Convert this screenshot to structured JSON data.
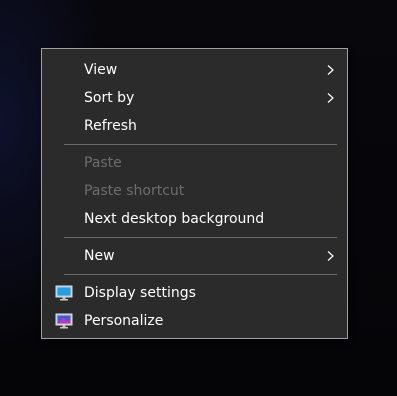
{
  "context_menu": {
    "items": [
      {
        "label": "View",
        "has_submenu": true,
        "enabled": true
      },
      {
        "label": "Sort by",
        "has_submenu": true,
        "enabled": true
      },
      {
        "label": "Refresh",
        "has_submenu": false,
        "enabled": true
      },
      {
        "label": "Paste",
        "has_submenu": false,
        "enabled": false
      },
      {
        "label": "Paste shortcut",
        "has_submenu": false,
        "enabled": false
      },
      {
        "label": "Next desktop background",
        "has_submenu": false,
        "enabled": true
      },
      {
        "label": "New",
        "has_submenu": true,
        "enabled": true
      },
      {
        "label": "Display settings",
        "has_submenu": false,
        "enabled": true,
        "icon": "display-settings-icon"
      },
      {
        "label": "Personalize",
        "has_submenu": false,
        "enabled": true,
        "icon": "personalize-icon"
      }
    ]
  },
  "colors": {
    "menu_background": "#2b2b2b",
    "menu_border": "#a0a0a0",
    "text": "#ffffff",
    "disabled_text": "#6d6d6d",
    "separator": "#6a6a6a"
  }
}
